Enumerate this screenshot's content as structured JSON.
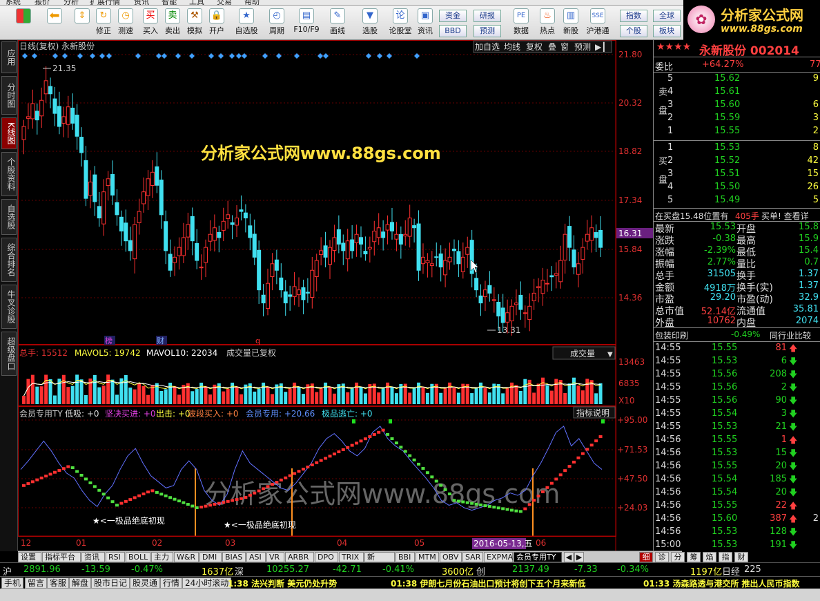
{
  "menu": [
    "系统",
    "报价",
    "分析",
    "扩展行情",
    "资讯",
    "智能",
    "工具",
    "交易",
    "帮助"
  ],
  "toolbar": {
    "buttons": [
      {
        "id": "fix",
        "label": "修正"
      },
      {
        "id": "test",
        "label": "测速"
      },
      {
        "id": "buy",
        "label": "买入",
        "icon": "买"
      },
      {
        "id": "sell",
        "label": "卖出",
        "icon": "卖"
      },
      {
        "id": "sim",
        "label": "模拟"
      },
      {
        "id": "open",
        "label": "开户"
      },
      {
        "id": "watch",
        "label": "自选股"
      },
      {
        "id": "period",
        "label": "周期"
      },
      {
        "id": "f10",
        "label": "F10/F9"
      },
      {
        "id": "draw",
        "label": "画线"
      },
      {
        "id": "pick",
        "label": "选股"
      },
      {
        "id": "forum",
        "label": "论股堂",
        "icon": "论"
      },
      {
        "id": "info",
        "label": "资讯"
      },
      {
        "id": "data",
        "label": "数据",
        "icon": "PE"
      },
      {
        "id": "hot",
        "label": "热点"
      },
      {
        "id": "newstock",
        "label": "新股"
      },
      {
        "id": "hk",
        "label": "沪港通"
      }
    ],
    "small": {
      "capital": "资金",
      "research": "研报",
      "bbd": "BBD",
      "forecast": "预测",
      "index": "指数",
      "global": "全球",
      "stock": "个股",
      "sector": "板块"
    }
  },
  "logo": {
    "text": "分析家公式网",
    "url": "www.88gs.com"
  },
  "lefttabs": [
    "应用",
    "分时图",
    "K线图",
    "个股资料",
    "自选股",
    "综合排名",
    "牛叉诊股",
    "超级盘口"
  ],
  "chart": {
    "header": "日线(复权) 永新股份",
    "buttons": [
      "加自选",
      "均线",
      "复权",
      "叠",
      "窗",
      "预测"
    ],
    "watermark1": "分析家公式网www.88gs.com",
    "watermark2": "分析家公式网www.88gs.com",
    "price_ticks": [
      "21.80",
      "20.32",
      "18.82",
      "17.34",
      "15.84",
      "14.36"
    ],
    "current_price": "16.31",
    "high_label": "21.35",
    "low_label": "13.31",
    "markers": [
      "榜",
      "财",
      "q"
    ],
    "vol_header": {
      "total": "总手: 15512",
      "mavol5": "MAVOL5: 19742",
      "mavol10": "MAVOL10: 22034",
      "note": "成交量已复权",
      "select": "成交量"
    },
    "vol_ticks": [
      "13463",
      "6835",
      "X10"
    ],
    "ind_header": {
      "name": "会员专用TY",
      "low": "低吸: +0",
      "firm": "坚决买进: +0",
      "out": "出击: +0",
      "band": "波段买入: +0",
      "member": "会员专用: +20.66",
      "escape": "极品逃亡: +0",
      "help": "指标说明"
    },
    "ind_ticks": [
      "+95.00",
      "+71.53",
      "+47.50",
      "+24.03"
    ],
    "annot": "★<一极品绝底初现",
    "x_ticks": [
      "12",
      "01",
      "02",
      "03",
      "04",
      "05",
      "06"
    ],
    "date_label": "2016-05-13,五"
  },
  "right": {
    "title": "永新股份 002014",
    "stars": "★★★★",
    "weibi_label": "委比",
    "weibi": "+64.27%",
    "weicha": "77",
    "sell_label": "卖盘",
    "buy_label": "买盘",
    "sell": [
      {
        "n": "5",
        "p": "15.62",
        "v": "9"
      },
      {
        "n": "4",
        "p": "15.61",
        "v": ""
      },
      {
        "n": "3",
        "p": "15.60",
        "v": "6"
      },
      {
        "n": "2",
        "p": "15.59",
        "v": "3"
      },
      {
        "n": "1",
        "p": "15.55",
        "v": "2"
      }
    ],
    "buy": [
      {
        "n": "1",
        "p": "15.53",
        "v": "8"
      },
      {
        "n": "2",
        "p": "15.52",
        "v": "42"
      },
      {
        "n": "3",
        "p": "15.51",
        "v": "15"
      },
      {
        "n": "4",
        "p": "15.50",
        "v": "26"
      },
      {
        "n": "5",
        "p": "15.49",
        "v": "5"
      }
    ],
    "notice": "在买盘15.48位置有",
    "notice_vol": "405手",
    "notice_tail": "买单! 查看详",
    "stats": [
      {
        "l": "最新",
        "v": "15.53",
        "l2": "开盘",
        "v2": "15.8"
      },
      {
        "l": "涨跌",
        "v": "-0.38",
        "l2": "最高",
        "v2": "15.9"
      },
      {
        "l": "涨幅",
        "v": "-2.39%",
        "l2": "最低",
        "v2": "15.4"
      },
      {
        "l": "振幅",
        "v": "2.77%",
        "l2": "量比",
        "v2": "0.7"
      },
      {
        "l": "总手",
        "v": "31505",
        "l2": "换手",
        "v2": "1.37"
      },
      {
        "l": "金额",
        "v": "4918万",
        "l2": "换手(实)",
        "v2": "1.37"
      },
      {
        "l": "市盈",
        "v": "29.20",
        "l2": "市盈(动)",
        "v2": "32.9"
      },
      {
        "l": "总市值",
        "v": "52.14亿",
        "l2": "流通值",
        "v2": "35.81"
      },
      {
        "l": "外盘",
        "v": "10762",
        "l2": "内盘",
        "v2": "2074"
      }
    ],
    "sector": "包装印刷",
    "sector_pct": "-0.49%",
    "compare": "同行业比较",
    "ticks": [
      {
        "t": "14:55",
        "p": "15.55",
        "v": "81",
        "d": "up"
      },
      {
        "t": "14:55",
        "p": "15.53",
        "v": "6",
        "d": "down"
      },
      {
        "t": "14:55",
        "p": "15.56",
        "v": "208",
        "d": "down"
      },
      {
        "t": "14:55",
        "p": "15.56",
        "v": "2",
        "d": "down"
      },
      {
        "t": "14:55",
        "p": "15.56",
        "v": "90",
        "d": "down"
      },
      {
        "t": "14:55",
        "p": "15.54",
        "v": "3",
        "d": "down"
      },
      {
        "t": "14:55",
        "p": "15.53",
        "v": "21",
        "d": "down"
      },
      {
        "t": "14:56",
        "p": "15.55",
        "v": "1",
        "d": "up"
      },
      {
        "t": "14:56",
        "p": "15.53",
        "v": "15",
        "d": "down"
      },
      {
        "t": "14:56",
        "p": "15.55",
        "v": "20",
        "d": "down"
      },
      {
        "t": "14:56",
        "p": "15.54",
        "v": "185",
        "d": "down"
      },
      {
        "t": "14:56",
        "p": "15.54",
        "v": "20",
        "d": "down"
      },
      {
        "t": "14:56",
        "p": "15.55",
        "v": "22",
        "d": "up"
      },
      {
        "t": "14:56",
        "p": "15.60",
        "v": "387",
        "d": "up",
        "x": "2"
      },
      {
        "t": "14:56",
        "p": "15.53",
        "v": "128",
        "d": "down"
      },
      {
        "t": "15:00",
        "p": "15.53",
        "v": "191",
        "d": "down"
      }
    ]
  },
  "tabbar": [
    "设置",
    "指标平台",
    "资讯",
    "RSI",
    "BOLL",
    "主力",
    "W&R",
    "DMI",
    "BIAS",
    "ASI",
    "VR",
    "ARBR",
    "DPO",
    "TRIX",
    "新DMA",
    "BBI",
    "MTM",
    "OBV",
    "SAR",
    "EXPMA",
    "会员专用TY"
  ],
  "sidetabs": [
    "细",
    "诊",
    "分",
    "筹",
    "焰",
    "指",
    "财"
  ],
  "indexbar": {
    "sh_label": "沪",
    "sh": "2891.96",
    "sh_chg": "-13.59",
    "sh_pct": "-0.47%",
    "sh_amt": "1637亿",
    "sz_label": "深",
    "sz": "10255.27",
    "sz_chg": "-42.71",
    "sz_pct": "-0.41%",
    "sz_amt": "3600亿",
    "cy_label": "创",
    "cy": "2137.49",
    "cy_chg": "-7.33",
    "cy_pct": "-0.34%",
    "cy_amt": "1197亿",
    "nk_label": "日经",
    "nk": "225"
  },
  "statusbar": {
    "buttons": [
      "手机",
      "留言",
      "客服",
      "解盘",
      "股市日记",
      "股灵通",
      "行情",
      "24小时滚动"
    ],
    "news1": "1:38 法兴判断 美元仍处升势",
    "news2": "01:38 伊朗七月份石油出口预计将创下五个月来新低",
    "news3": "01:33 汤森路透与港交所 推出人民币指数"
  }
}
